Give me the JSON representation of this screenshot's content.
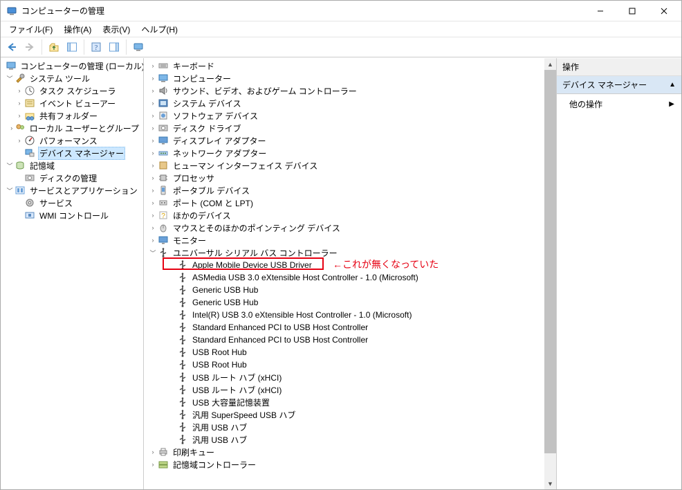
{
  "window": {
    "title": "コンピューターの管理",
    "minimize": "–",
    "maximize": "□",
    "close": "✕"
  },
  "menu": {
    "file": "ファイル(F)",
    "action": "操作(A)",
    "view": "表示(V)",
    "help": "ヘルプ(H)"
  },
  "left_tree": {
    "root": "コンピューターの管理 (ローカル)",
    "system_tools": "システム ツール",
    "task_scheduler": "タスク スケジューラ",
    "event_viewer": "イベント ビューアー",
    "shared_folders": "共有フォルダー",
    "local_users": "ローカル ユーザーとグループ",
    "performance": "パフォーマンス",
    "device_manager": "デバイス マネージャー",
    "storage": "記憶域",
    "disk_mgmt": "ディスクの管理",
    "services_apps": "サービスとアプリケーション",
    "services": "サービス",
    "wmi": "WMI コントロール"
  },
  "devices": {
    "categories": [
      "キーボード",
      "コンピューター",
      "サウンド、ビデオ、およびゲーム コントローラー",
      "システム デバイス",
      "ソフトウェア デバイス",
      "ディスク ドライブ",
      "ディスプレイ アダプター",
      "ネットワーク アダプター",
      "ヒューマン インターフェイス デバイス",
      "プロセッサ",
      "ポータブル デバイス",
      "ポート (COM と LPT)",
      "ほかのデバイス",
      "マウスとそのほかのポインティング デバイス",
      "モニター",
      "ユニバーサル シリアル バス コントローラー"
    ],
    "usb_items": [
      "Apple Mobile Device USB Driver",
      "ASMedia USB 3.0 eXtensible Host Controller - 1.0 (Microsoft)",
      "Generic USB Hub",
      "Generic USB Hub",
      "Intel(R) USB 3.0 eXtensible Host Controller - 1.0 (Microsoft)",
      "Standard Enhanced PCI to USB Host Controller",
      "Standard Enhanced PCI to USB Host Controller",
      "USB Root Hub",
      "USB Root Hub",
      "USB ルート ハブ (xHCI)",
      "USB ルート ハブ (xHCI)",
      "USB 大容量記憶装置",
      "汎用 SuperSpeed USB ハブ",
      "汎用 USB ハブ",
      "汎用 USB ハブ"
    ],
    "tail_categories": [
      "印刷キュー",
      "記憶域コントローラー"
    ]
  },
  "annotation": {
    "text": "←これが無くなっていた"
  },
  "actions": {
    "header": "操作",
    "group": "デバイス マネージャー",
    "more": "他の操作"
  }
}
